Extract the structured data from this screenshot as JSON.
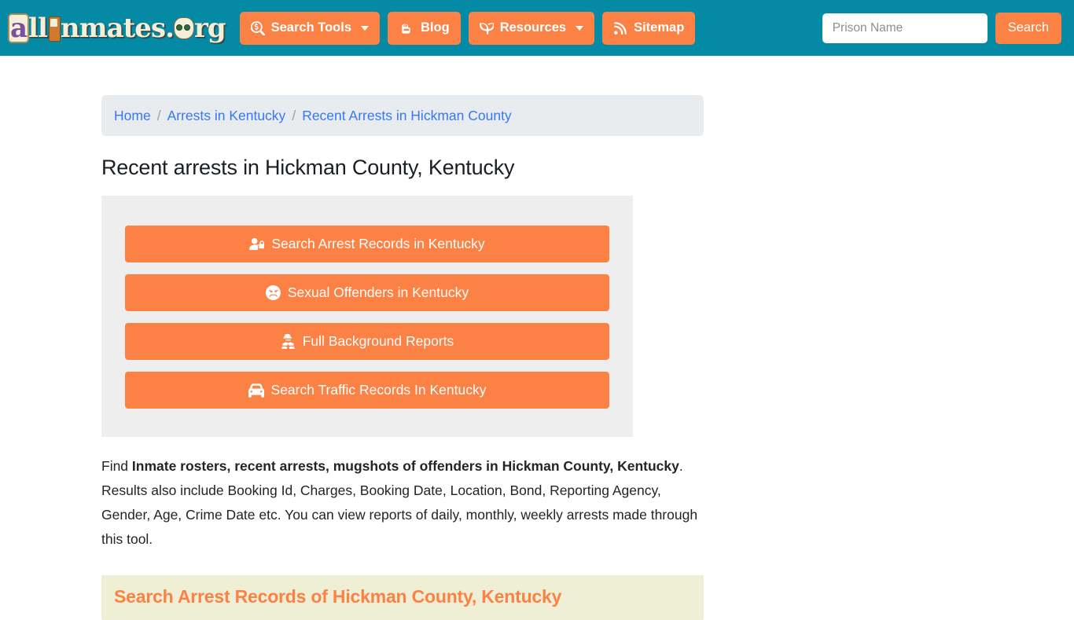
{
  "header": {
    "brand": {
      "text_a": "a",
      "text_ll": "ll",
      "text_nmates": "nmates",
      "text_dot": ".",
      "text_rg": "rg",
      "full_name": "allInmates.org"
    },
    "nav": [
      {
        "label": "Search Tools",
        "icon": "search-dollar-icon",
        "has_caret": true
      },
      {
        "label": "Blog",
        "icon": "blogger-b-icon",
        "has_caret": false
      },
      {
        "label": "Resources",
        "icon": "seedling-icon",
        "has_caret": true
      },
      {
        "label": "Sitemap",
        "icon": "rss-feed-icon",
        "has_caret": false
      }
    ],
    "search": {
      "placeholder": "Prison Name",
      "value": "",
      "button_label": "Search"
    }
  },
  "breadcrumb": {
    "items": [
      {
        "label": "Home"
      },
      {
        "label": "Arrests in Kentucky"
      },
      {
        "label": "Recent Arrests in Hickman County"
      }
    ],
    "separator": "/"
  },
  "main": {
    "title": "Recent arrests in Hickman County, Kentucky",
    "action_buttons": [
      {
        "label": "Search Arrest Records in Kentucky",
        "icon": "user-lock-icon"
      },
      {
        "label": "Sexual Offenders in Kentucky",
        "icon": "angry-face-icon"
      },
      {
        "label": "Full Background Reports",
        "icon": "user-secret-icon"
      },
      {
        "label": "Search Traffic Records In Kentucky",
        "icon": "car-icon"
      }
    ],
    "paragraph": {
      "part1": "Find ",
      "bold1": "Inmate rosters, recent arrests, mugshots of offenders in Hickman County, Kentucky",
      "part2": ". Results also include Booking Id, Charges, Booking Date, Location, Bond, Reporting Agency, Gender, Age, Crime Date etc. You can view reports of daily, monthly, weekly arrests made through this tool."
    },
    "section_heading": "Search Arrest Records of Hickman County, Kentucky"
  },
  "colors": {
    "header_teal": "#048AA4",
    "accent_orange": "#FB8144",
    "link_blue": "#3478F6",
    "breadcrumb_bg": "#E9ECEF",
    "panel_gray": "#EEEEEE",
    "section_bg": "#EFEFD6"
  }
}
